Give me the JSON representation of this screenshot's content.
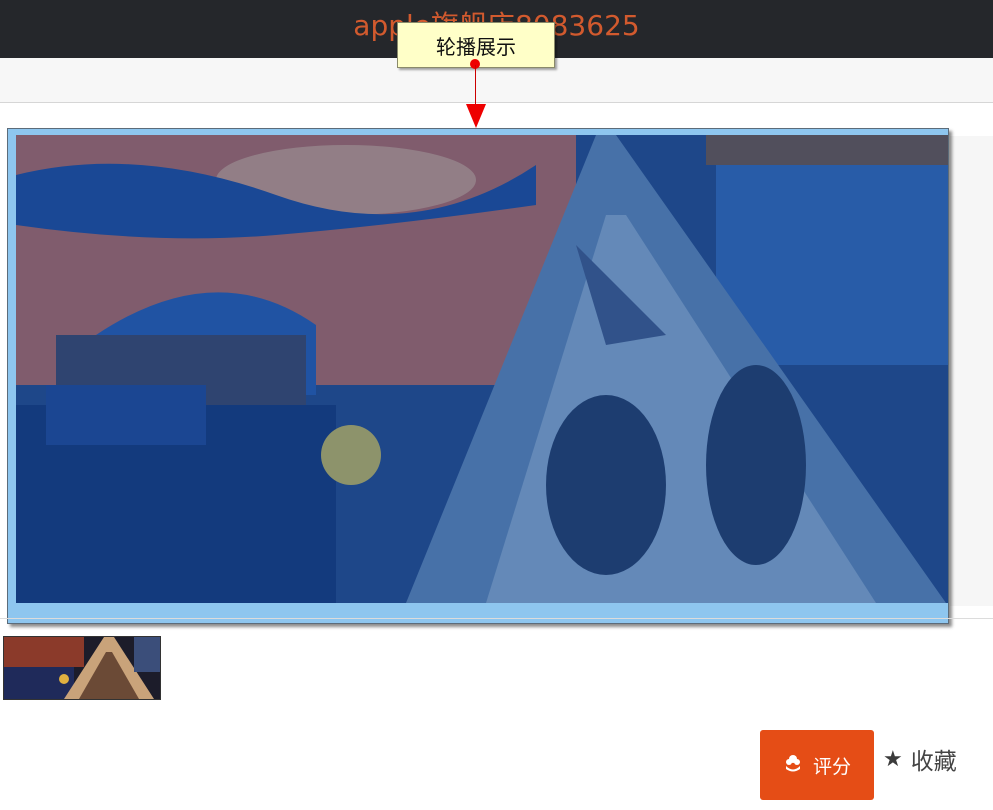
{
  "header": {
    "store_title": "apple旗舰店8083625"
  },
  "annotation": {
    "tooltip_label": "轮播展示"
  },
  "carousel": {
    "image_icon": "kids-tent-bedroom-photo",
    "overlay_color": "#1e5aa8",
    "frame_color": "#8ec6ef"
  },
  "thumbnail": {
    "image_icon": "kids-tent-bedroom-photo-thumbnail"
  },
  "actions": {
    "rate_label": "评分",
    "rate_icon": "flower-icon",
    "rate_color": "#e54d16",
    "favorite_label": "收藏",
    "favorite_icon": "star-icon"
  }
}
